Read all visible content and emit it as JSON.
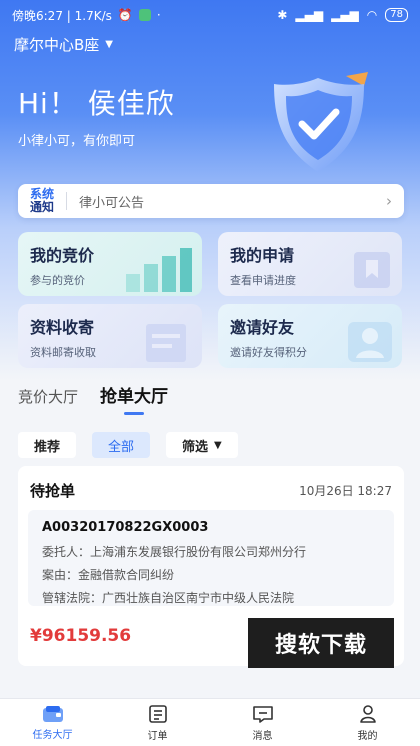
{
  "status_bar": {
    "left_text": "傍晚6:27 | 1.7K/s",
    "battery": "78"
  },
  "header": {
    "location": "摩尔中心B座",
    "greeting": "Hi！ 侯佳欣",
    "subtitle": "小律小可，有你即可"
  },
  "notice": {
    "tag_line1": "系统",
    "tag_line2": "通知",
    "text": "律小可公告",
    "arrow": "›"
  },
  "cards": [
    {
      "title": "我的竞价",
      "subtitle": "参与的竞价"
    },
    {
      "title": "我的申请",
      "subtitle": "查看申请进度"
    },
    {
      "title": "资料收寄",
      "subtitle": "资料邮寄收取"
    },
    {
      "title": "邀请好友",
      "subtitle": "邀请好友得积分"
    }
  ],
  "tabs": [
    {
      "label": "竞价大厅"
    },
    {
      "label": "抢单大厅"
    }
  ],
  "filters": {
    "recommend": "推荐",
    "all": "全部",
    "filter": "筛选"
  },
  "order": {
    "status": "待抢单",
    "date": "10月26日 18:27",
    "code": "A00320170822GX0003",
    "client": "委托人：上海浦东发展银行股份有限公司郑州分行",
    "case": "案由：金融借款合同纠纷",
    "court": "管辖法院：广西壮族自治区南宁市中级人民法院",
    "price": "¥96159.56"
  },
  "watermark": "搜软下载",
  "bottom_nav": [
    {
      "label": "任务大厅",
      "icon": "task-hall-icon"
    },
    {
      "label": "订单",
      "icon": "order-icon"
    },
    {
      "label": "消息",
      "icon": "message-icon"
    },
    {
      "label": "我的",
      "icon": "profile-icon"
    }
  ],
  "colors": {
    "primary": "#3f78f2",
    "price": "#e23b3b"
  }
}
